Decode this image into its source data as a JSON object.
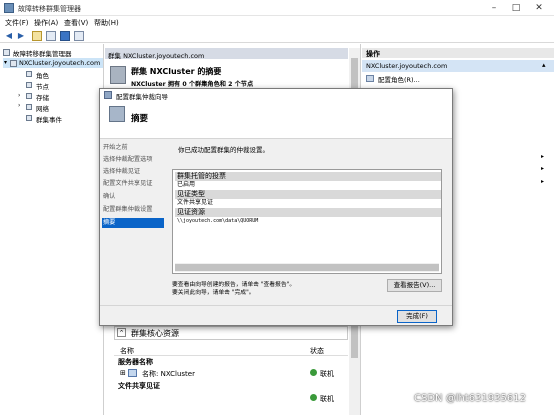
{
  "window": {
    "title": "故障转移群集管理器"
  },
  "menubar": [
    "文件(F)",
    "操作(A)",
    "查看(V)",
    "帮助(H)"
  ],
  "tree": {
    "root": "故障转移群集管理器",
    "cluster": "NXCluster.joyoutech.com",
    "children": [
      "角色",
      "节点",
      "存储",
      "网络",
      "群集事件"
    ]
  },
  "middle": {
    "header": "群集 NXCluster.joyoutech.com",
    "summary_title": "群集 NXCluster 的摘要",
    "summary_sub": "NXCluster 拥有 0 个群集角色和 2 个节点",
    "core_section": "群集核心资源",
    "columns": {
      "name": "名称",
      "status": "状态"
    },
    "server_name_group": "服务器名称",
    "server_name_row": "名称: NXCluster",
    "server_status": "联机",
    "witness_group": "文件共享见证",
    "witness_status": "联机"
  },
  "actions": {
    "header": "操作",
    "selected": "NXCluster.joyoutech.com",
    "item1": "配置角色(R)..."
  },
  "dialog": {
    "window_title": "配置群集仲裁向导",
    "page_title": "摘要",
    "nav": [
      "开始之前",
      "选择仲裁配置选项",
      "选择仲裁见证",
      "配置文件共享见证",
      "确认",
      "配置群集仲裁设置",
      "摘要"
    ],
    "message": "你已成功配置群集的仲裁设置。",
    "report": {
      "h1": "群集托管的投票",
      "r1": "已启用",
      "h2": "见证类型",
      "r2": "文件共享见证",
      "h3": "见证资源",
      "r3": "\\\\joyoutech.com\\data\\QUORUM"
    },
    "hint1": "要查看由向导创建的报告，请单击 \"查看报告\"。",
    "hint2": "要关闭此向导，请单击 \"完成\"。",
    "view_report": "查看报告(V)...",
    "finish": "完成(F)"
  },
  "watermark": "CSDN @lht631935612"
}
